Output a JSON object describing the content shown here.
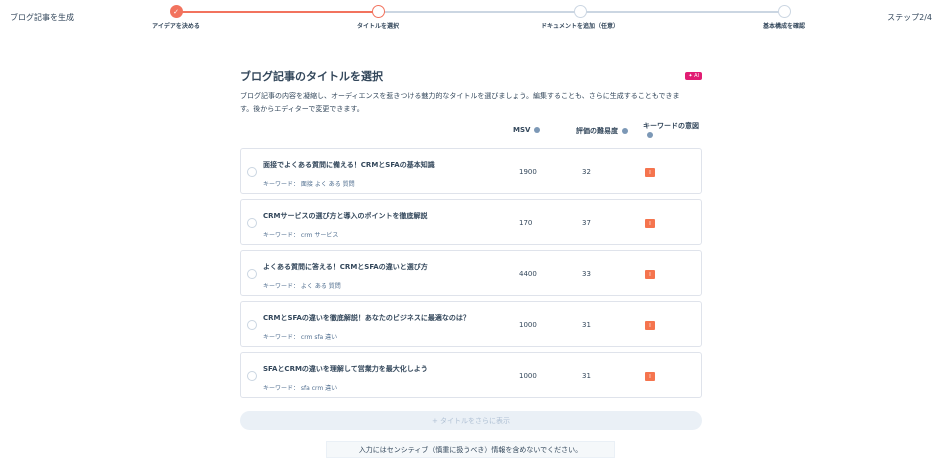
{
  "app": {
    "title": "ブログ記事を生成",
    "step_indicator": "ステップ2/4"
  },
  "steps": [
    {
      "label": "アイデアを決める",
      "state": "done"
    },
    {
      "label": "タイトルを選択",
      "state": "active"
    },
    {
      "label": "ドキュメントを追加（任意）",
      "state": "todo"
    },
    {
      "label": "基本構成を確認",
      "state": "todo"
    }
  ],
  "panel": {
    "title": "ブログ記事のタイトルを選択",
    "ai_badge": "✦ AI",
    "description": "ブログ記事の内容を凝縮し、オーディエンスを惹きつける魅力的なタイトルを選びましょう。編集することも、さらに生成することもできます。後からエディターで変更できます。"
  },
  "columns": {
    "msv": "MSV",
    "difficulty": "評価の難易度",
    "intent": "キーワードの意図"
  },
  "rows": [
    {
      "title": "面接でよくある質問に備える！CRMとSFAの基本知識",
      "keyword": "キーワード：  面接 よく ある 質問",
      "msv": "1900",
      "difficulty": "32",
      "intent": "I"
    },
    {
      "title": "CRMサービスの選び方と導入のポイントを徹底解説",
      "keyword": "キーワード：  crm サービス",
      "msv": "170",
      "difficulty": "37",
      "intent": "I"
    },
    {
      "title": "よくある質問に答える！CRMとSFAの違いと選び方",
      "keyword": "キーワード：  よく ある 質問",
      "msv": "4400",
      "difficulty": "33",
      "intent": "I"
    },
    {
      "title": "CRMとSFAの違いを徹底解説！あなたのビジネスに最適なのは？",
      "keyword": "キーワード：  crm sfa 違い",
      "msv": "1000",
      "difficulty": "31",
      "intent": "I"
    },
    {
      "title": "SFAとCRMの違いを理解して営業力を最大化しよう",
      "keyword": "キーワード：  sfa crm 違い",
      "msv": "1000",
      "difficulty": "31",
      "intent": "I"
    }
  ],
  "more_button": "+ タイトルをさらに表示",
  "notice": "入力にはセンシティブ（慎重に扱うべき）情報を含めないでください。",
  "colors": {
    "accent": "#f2735e",
    "ai_badge": "#e11d73",
    "intent_badge": "#f5744e"
  }
}
